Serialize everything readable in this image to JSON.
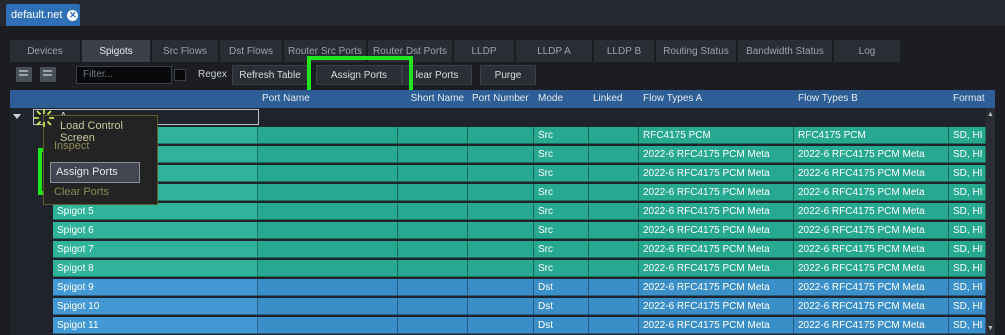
{
  "window": {
    "doc_tab": "default.net",
    "close_glyph": "✕"
  },
  "tabs": [
    {
      "label": "Devices",
      "active": false
    },
    {
      "label": "Spigots",
      "active": true
    },
    {
      "label": "Src Flows",
      "active": false
    },
    {
      "label": "Dst Flows",
      "active": false
    },
    {
      "label": "Router Src Ports",
      "active": false
    },
    {
      "label": "Router Dst Ports",
      "active": false
    },
    {
      "label": "LLDP",
      "active": false
    },
    {
      "label": "LLDP A",
      "active": false
    },
    {
      "label": "LLDP B",
      "active": false
    },
    {
      "label": "Routing Status",
      "active": false
    },
    {
      "label": "Bandwidth Status",
      "active": false
    },
    {
      "label": "Log",
      "active": false
    }
  ],
  "toolbar": {
    "filter_placeholder": "Filter...",
    "regex_label": "Regex",
    "refresh_label": "Refresh Table",
    "assign_label": "Assign Ports",
    "clear_label": "lear Ports",
    "purge_label": "Purge"
  },
  "columns": {
    "port_name": "Port Name",
    "short_name": "Short Name",
    "port_number": "Port Number",
    "mode": "Mode",
    "linked": "Linked",
    "flow_types_a": "Flow Types A",
    "flow_types_b": "Flow Types B",
    "format": "Format"
  },
  "tree_node_label": "A",
  "rows": [
    {
      "name": "",
      "mode": "Src",
      "a": "RFC4175  PCM",
      "b": "RFC4175  PCM",
      "format": "SD, HI",
      "kind": "src"
    },
    {
      "name": "",
      "mode": "Src",
      "a": "2022-6  RFC4175  PCM  Meta",
      "b": "2022-6  RFC4175  PCM  Meta",
      "format": "SD, HI",
      "kind": "src"
    },
    {
      "name": "",
      "mode": "Src",
      "a": "2022-6  RFC4175  PCM  Meta",
      "b": "2022-6  RFC4175  PCM  Meta",
      "format": "SD, HI",
      "kind": "src"
    },
    {
      "name": "",
      "mode": "Src",
      "a": "2022-6  RFC4175  PCM  Meta",
      "b": "2022-6  RFC4175  PCM  Meta",
      "format": "SD, HI",
      "kind": "src"
    },
    {
      "name": "Spigot 5",
      "mode": "Src",
      "a": "2022-6  RFC4175  PCM  Meta",
      "b": "2022-6  RFC4175  PCM  Meta",
      "format": "SD, HI",
      "kind": "src"
    },
    {
      "name": "Spigot 6",
      "mode": "Src",
      "a": "2022-6  RFC4175  PCM  Meta",
      "b": "2022-6  RFC4175  PCM  Meta",
      "format": "SD, HI",
      "kind": "src"
    },
    {
      "name": "Spigot 7",
      "mode": "Src",
      "a": "2022-6  RFC4175  PCM  Meta",
      "b": "2022-6  RFC4175  PCM  Meta",
      "format": "SD, HI",
      "kind": "src"
    },
    {
      "name": "Spigot 8",
      "mode": "Src",
      "a": "2022-6  RFC4175  PCM  Meta",
      "b": "2022-6  RFC4175  PCM  Meta",
      "format": "SD, HI",
      "kind": "src"
    },
    {
      "name": "Spigot 9",
      "mode": "Dst",
      "a": "2022-6  RFC4175  PCM  Meta",
      "b": "2022-6  RFC4175  PCM  Meta",
      "format": "SD, HI",
      "kind": "dst"
    },
    {
      "name": "Spigot 10",
      "mode": "Dst",
      "a": "2022-6  RFC4175  PCM  Meta",
      "b": "2022-6  RFC4175  PCM  Meta",
      "format": "SD, HI",
      "kind": "dst"
    },
    {
      "name": "Spigot 11",
      "mode": "Dst",
      "a": "2022-6  RFC4175  PCM  Meta",
      "b": "2022-6  RFC4175  PCM  Meta",
      "format": "SD, HI",
      "kind": "dst"
    }
  ],
  "context_menu": {
    "load_control": "Load Control Screen",
    "inspect": "Inspect",
    "assign_ports": "Assign Ports",
    "clear_ports": "Clear Ports"
  },
  "colors": {
    "src_row": "#27a890",
    "src_row_light": "#2fb39b",
    "dst_row": "#3a8fc9",
    "dst_row_light": "#4399d3",
    "header": "#2d5e96",
    "highlight": "#1ee61e",
    "tab_active": "#2e6fb5"
  },
  "icons": {
    "expand": "tree-expand-icon",
    "loading": "spinner-icon"
  }
}
